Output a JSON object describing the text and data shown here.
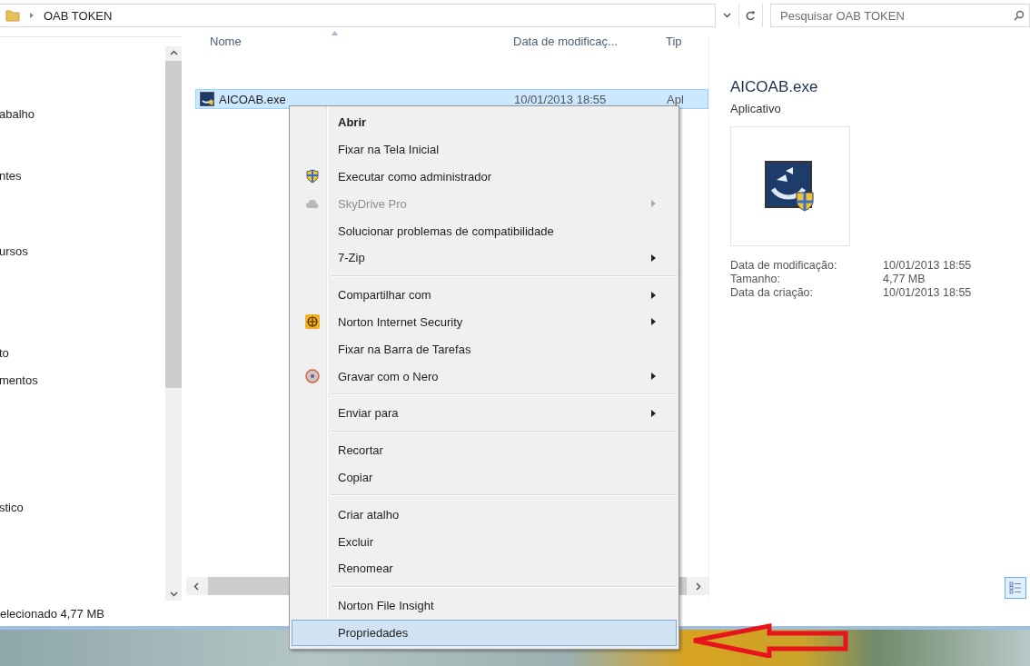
{
  "address_bar": {
    "path": "OAB TOKEN"
  },
  "search": {
    "placeholder": "Pesquisar OAB TOKEN"
  },
  "nav_items": [
    "abalho",
    "ntes",
    "ursos",
    "to",
    "mentos",
    "stico"
  ],
  "columns": [
    "Nome",
    "Data de modificaç...",
    "Tip"
  ],
  "files": [
    {
      "name": "AICOAB.exe",
      "modified": "10/01/2013 18:55",
      "type": "Apl",
      "selected": true
    }
  ],
  "preview": {
    "title": "AICOAB.exe",
    "type": "Aplicativo",
    "details": [
      {
        "label": "Data de modificação:",
        "value": "10/01/2013 18:55"
      },
      {
        "label": "Tamanho:",
        "value": "4,77 MB"
      },
      {
        "label": "Data da criação:",
        "value": "10/01/2013 18:55"
      }
    ]
  },
  "status_bar": {
    "text": "elecionado 4,77 MB"
  },
  "context_menu": [
    {
      "kind": "item",
      "label": "Abrir",
      "default": true,
      "disabled": false,
      "submenu": false,
      "selected": false
    },
    {
      "kind": "item",
      "label": "Fixar na Tela Inicial",
      "default": false,
      "disabled": false,
      "submenu": false,
      "selected": false
    },
    {
      "kind": "item",
      "label": "Executar como administrador",
      "default": false,
      "disabled": false,
      "submenu": false,
      "selected": false
    },
    {
      "kind": "item",
      "label": "SkyDrive Pro",
      "default": false,
      "disabled": true,
      "submenu": true,
      "selected": false
    },
    {
      "kind": "item",
      "label": "Solucionar problemas de compatibilidade",
      "default": false,
      "disabled": false,
      "submenu": false,
      "selected": false
    },
    {
      "kind": "item",
      "label": "7-Zip",
      "default": false,
      "disabled": false,
      "submenu": true,
      "selected": false
    },
    {
      "kind": "separator"
    },
    {
      "kind": "item",
      "label": "Compartilhar com",
      "default": false,
      "disabled": false,
      "submenu": true,
      "selected": false
    },
    {
      "kind": "item",
      "label": "Norton Internet Security",
      "default": false,
      "disabled": false,
      "submenu": true,
      "selected": false
    },
    {
      "kind": "item",
      "label": "Fixar na Barra de Tarefas",
      "default": false,
      "disabled": false,
      "submenu": false,
      "selected": false
    },
    {
      "kind": "item",
      "label": "Gravar com o Nero",
      "default": false,
      "disabled": false,
      "submenu": true,
      "selected": false
    },
    {
      "kind": "separator"
    },
    {
      "kind": "item",
      "label": "Enviar para",
      "default": false,
      "disabled": false,
      "submenu": true,
      "selected": false
    },
    {
      "kind": "separator"
    },
    {
      "kind": "item",
      "label": "Recortar",
      "default": false,
      "disabled": false,
      "submenu": false,
      "selected": false
    },
    {
      "kind": "item",
      "label": "Copiar",
      "default": false,
      "disabled": false,
      "submenu": false,
      "selected": false
    },
    {
      "kind": "separator"
    },
    {
      "kind": "item",
      "label": "Criar atalho",
      "default": false,
      "disabled": false,
      "submenu": false,
      "selected": false
    },
    {
      "kind": "item",
      "label": "Excluir",
      "default": false,
      "disabled": false,
      "submenu": false,
      "selected": false
    },
    {
      "kind": "item",
      "label": "Renomear",
      "default": false,
      "disabled": false,
      "submenu": false,
      "selected": false
    },
    {
      "kind": "separator"
    },
    {
      "kind": "item",
      "label": "Norton File Insight",
      "default": false,
      "disabled": false,
      "submenu": false,
      "selected": false
    },
    {
      "kind": "item",
      "label": "Propriedades",
      "default": false,
      "disabled": false,
      "submenu": false,
      "selected": true
    }
  ]
}
